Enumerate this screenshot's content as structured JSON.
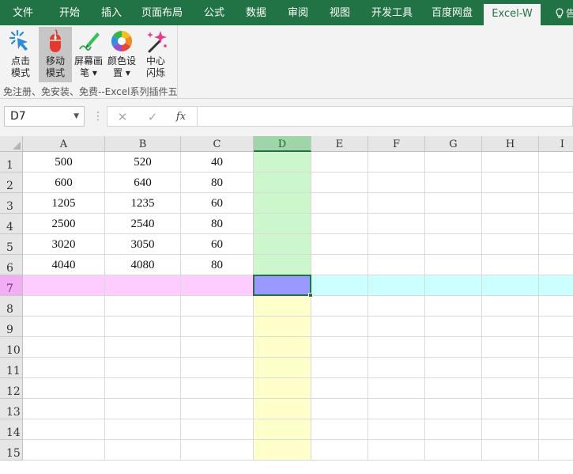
{
  "ribbon_tabs": [
    "文件",
    "开始",
    "插入",
    "页面布局",
    "公式",
    "数据",
    "审阅",
    "视图",
    "开发工具",
    "百度网盘",
    "Excel-W"
  ],
  "tab_partial": "告",
  "ribbon": {
    "buttons": [
      {
        "line1": "点击",
        "line2": "模式",
        "icon": "cursor-click-icon"
      },
      {
        "line1": "移动",
        "line2": "模式",
        "icon": "mouse-icon",
        "pressed": true
      },
      {
        "line1": "屏幕画",
        "line2": "笔 ▾",
        "icon": "pen-icon"
      },
      {
        "line1": "颜色设",
        "line2": "置 ▾",
        "icon": "color-wheel-icon"
      },
      {
        "line1": "中心",
        "line2": "闪烁",
        "icon": "sparkle-wand-icon"
      }
    ],
    "group_label": "免注册、免安装、免费--Excel系列插件五"
  },
  "formula_bar": {
    "name_box": "D7",
    "cancel_symbol": "✕",
    "enter_symbol": "✓",
    "fx_label": "fx",
    "formula": ""
  },
  "columns": [
    "A",
    "B",
    "C",
    "D",
    "E",
    "F",
    "G",
    "H",
    "I"
  ],
  "rows": [
    "1",
    "2",
    "3",
    "4",
    "5",
    "6",
    "7",
    "8",
    "9",
    "10",
    "11",
    "12",
    "13",
    "14",
    "15"
  ],
  "selected_cell": {
    "column": "D",
    "row": "7"
  },
  "highlight_colors": {
    "active_cell": "#9999ff",
    "column_above": "#ccf7cc",
    "column_below": "#ffffcc",
    "row_left": "#ffccff",
    "row_right": "#ccffff",
    "accent": "#217346"
  },
  "cells": [
    [
      "500",
      "520",
      "40"
    ],
    [
      "600",
      "640",
      "80"
    ],
    [
      "1205",
      "1235",
      "60"
    ],
    [
      "2500",
      "2540",
      "80"
    ],
    [
      "3020",
      "3050",
      "60"
    ],
    [
      "4040",
      "4080",
      "80"
    ]
  ]
}
